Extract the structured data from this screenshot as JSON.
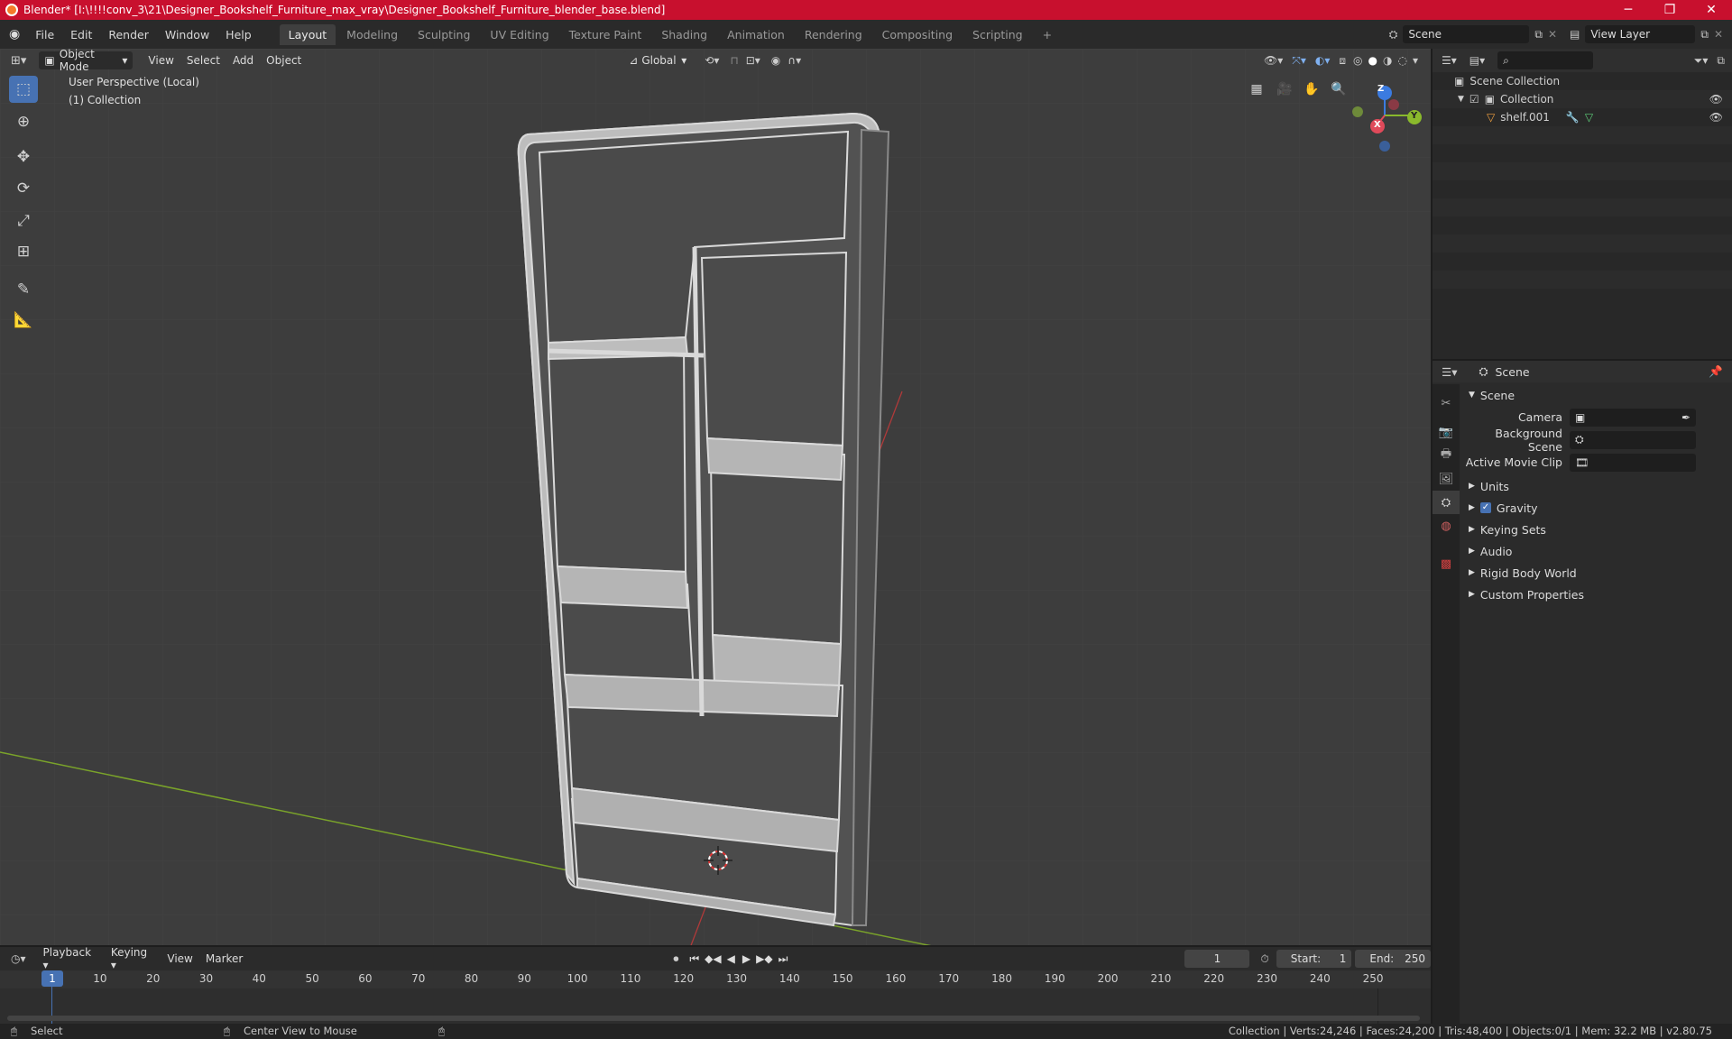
{
  "window": {
    "title": "Blender* [I:\\!!!!conv_3\\21\\Designer_Bookshelf_Furniture_max_vray\\Designer_Bookshelf_Furniture_blender_base.blend]",
    "minimize": "─",
    "maximize": "❐",
    "close": "✕"
  },
  "menus": [
    "File",
    "Edit",
    "Render",
    "Window",
    "Help"
  ],
  "workspaces": [
    "Layout",
    "Modeling",
    "Sculpting",
    "UV Editing",
    "Texture Paint",
    "Shading",
    "Animation",
    "Rendering",
    "Compositing",
    "Scripting"
  ],
  "add_workspace": "+",
  "scene_field": "Scene",
  "view_layer_field": "View Layer",
  "viewport": {
    "mode": "Object Mode",
    "header_menus": [
      "View",
      "Select",
      "Add",
      "Object"
    ],
    "orientation": "Global",
    "overlay_text_line1": "User Perspective (Local)",
    "overlay_text_line2": "(1) Collection",
    "gizmo": {
      "x": "X",
      "y": "Y",
      "z": "Z"
    }
  },
  "outliner": {
    "scene_collection": "Scene Collection",
    "collection": "Collection",
    "object": "shelf.001"
  },
  "properties": {
    "context": "Scene",
    "section": "Scene",
    "camera_label": "Camera",
    "background_scene_label": "Background Scene",
    "active_movie_clip_label": "Active Movie Clip",
    "panels": [
      "Units",
      "Gravity",
      "Keying Sets",
      "Audio",
      "Rigid Body World",
      "Custom Properties"
    ]
  },
  "timeline": {
    "menus": [
      "Playback",
      "Keying",
      "View",
      "Marker"
    ],
    "current_frame": "1",
    "start_label": "Start:",
    "start": "1",
    "end_label": "End:",
    "end": "250",
    "ruler": [
      "1",
      "10",
      "20",
      "30",
      "40",
      "50",
      "60",
      "70",
      "80",
      "90",
      "100",
      "110",
      "120",
      "130",
      "140",
      "150",
      "160",
      "170",
      "180",
      "190",
      "200",
      "210",
      "220",
      "230",
      "240",
      "250"
    ]
  },
  "status": {
    "select": "Select",
    "center_view": "Center View to Mouse",
    "stats": "Collection | Verts:24,246 | Faces:24,200 | Tris:48,400 | Objects:0/1 | Mem: 32.2 MB | v2.80.75"
  }
}
